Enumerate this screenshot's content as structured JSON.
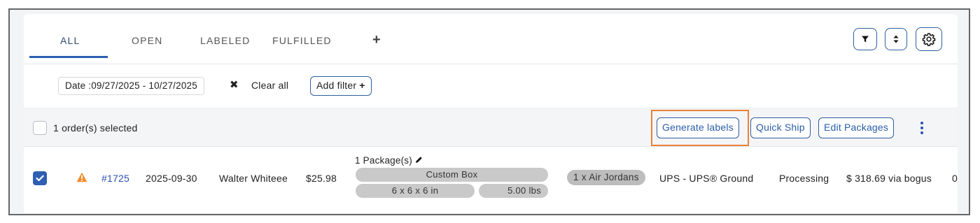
{
  "tabs": {
    "all": "ALL",
    "open": "OPEN",
    "labeled": "LABELED",
    "fulfilled": "FULFILLED",
    "add": "+"
  },
  "toolbar": {
    "filter_icon": "filter-icon",
    "sort_icon": "sort-icon",
    "settings_icon": "gear-icon"
  },
  "filters": {
    "date_chip": "Date :09/27/2025 - 10/27/2025",
    "clear_x": "✖",
    "clear_all": "Clear all",
    "add_filter": "Add filter",
    "add_filter_plus": "+"
  },
  "selection": {
    "text": "1 order(s) selected",
    "generate_labels": "Generate labels",
    "quick_ship": "Quick Ship",
    "edit_packages": "Edit Packages"
  },
  "order": {
    "number": "#1725",
    "date": "2025-09-30",
    "customer": "Walter Whiteee",
    "total": "$25.98",
    "packages_title": "1 Package(s)",
    "box_name": "Custom Box",
    "dimensions": "6 x 6 x 6 in",
    "weight": "5.00 lbs",
    "items": "1 x Air Jordans",
    "carrier": "UPS - UPS® Ground",
    "status": "Processing",
    "rate": "$ 318.69 via bogus",
    "overflow": "0"
  },
  "colors": {
    "accent_blue": "#2f5fb3",
    "highlight_orange": "#e8833a",
    "warning": "#f08c2e"
  }
}
